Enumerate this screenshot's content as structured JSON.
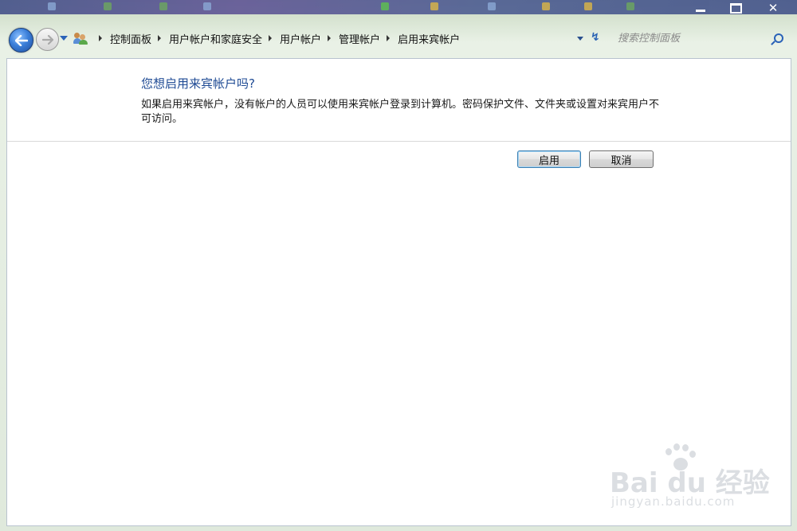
{
  "window": {
    "close_glyph": "✕"
  },
  "nav": {
    "breadcrumbs": [
      {
        "label": "控制面板"
      },
      {
        "label": "用户帐户和家庭安全"
      },
      {
        "label": "用户帐户"
      },
      {
        "label": "管理帐户"
      },
      {
        "label": "启用来宾帐户"
      }
    ],
    "refresh_glyph": "↯",
    "search_placeholder": "搜索控制面板"
  },
  "dialog": {
    "question": "您想启用来宾帐户吗?",
    "description": "如果启用来宾帐户，没有帐户的人员可以使用来宾帐户登录到计算机。密码保护文件、文件夹或设置对来宾用户不可访问。",
    "enable_label": "启用",
    "cancel_label": "取消"
  },
  "watermark": {
    "url": "jingyan.baidu.com"
  },
  "icons": {
    "back": "back-arrow-icon",
    "forward": "forward-arrow-icon",
    "users": "users-icon",
    "search": "search-icon"
  },
  "colors": {
    "heading": "#1e4a94",
    "accent": "#2a62b8"
  }
}
